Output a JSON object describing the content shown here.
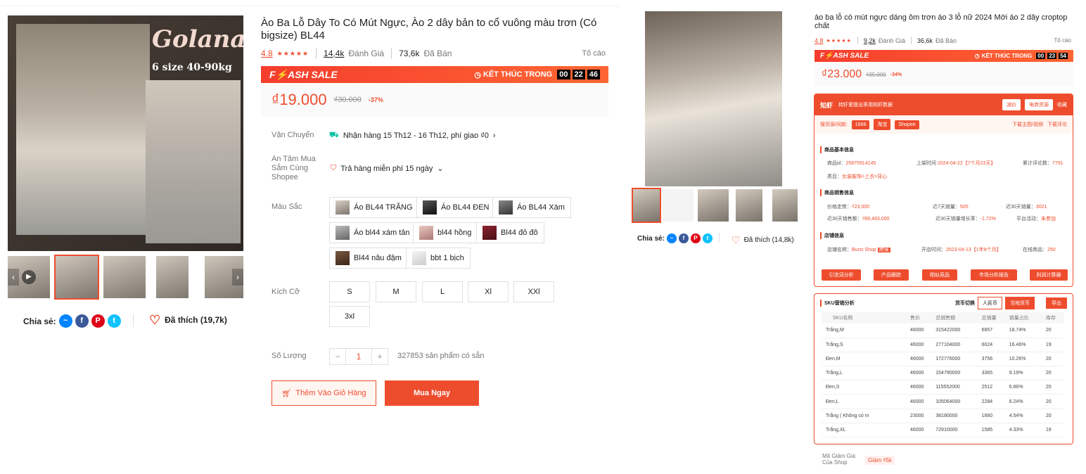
{
  "left": {
    "brand": "Golana",
    "brand_sub": "6 size 40-90kg",
    "title": "Ào Ba Lỗ Dây To Có Mút Ngực, Ào 2 dây bản to cổ vuông màu trơn (Có bigsize) BL44",
    "rating": "4.8",
    "stars": "★★★★★",
    "reviews_count": "14,4k",
    "reviews_label": "Đánh Giá",
    "sold_count": "73,6k",
    "sold_label": "Đã Bán",
    "report": "Tố cáo",
    "flash_title": "F⚡ASH SALE",
    "flash_end_label": "KẾT THÚC TRONG",
    "timer": [
      "00",
      "22",
      "46"
    ],
    "price": "₫19.000",
    "old_price": "₫30.000",
    "discount": "-37%",
    "shipping_label": "Vận Chuyển",
    "shipping_value": "Nhận hàng 15 Th12 - 16 Th12, phí giao ₫0",
    "assurance_label": "An Tâm Mua Sắm Cùng Shopee",
    "assurance_value": "Trả hàng miễn phí 15 ngày",
    "color_label": "Màu Sắc",
    "colors": [
      "Áo BL44 TRẮNG",
      "Áo BL44 ĐEN",
      "Áo BL44 Xám",
      "Áo bl44 xám tản",
      "bl44 hồng",
      "Bl44 đỏ đô",
      "Bl44 nâu đậm",
      "bbt 1 bịch"
    ],
    "size_label": "Kích Cỡ",
    "sizes": [
      "S",
      "M",
      "L",
      "Xl",
      "XXl",
      "3xl"
    ],
    "qty_label": "Số Lượng",
    "qty_minus": "−",
    "qty_value": "1",
    "qty_plus": "+",
    "stock": "327853 sản phẩm có sẵn",
    "add_cart": "Thêm Vào Giỏ Hàng",
    "buy_now": "Mua Ngay",
    "share_label": "Chia sẻ:",
    "liked": "Đã thích (19,7k)"
  },
  "middle": {
    "share_label": "Chia sẻ:",
    "liked": "Đã thích (14,8k)"
  },
  "right": {
    "title": "áo ba lỗ có mút ngực dáng ôm trơn áo 3 lỗ nữ 2024 Mới áo 2 dây croptop chất",
    "rating": "4.8",
    "stars": "★★★★★",
    "reviews_count": "9,2k",
    "reviews_label": "Đánh Giá",
    "sold_count": "36,6k",
    "sold_label": "Đã Bán",
    "report": "Tố cáo",
    "flash_title": "F⚡ASH SALE",
    "flash_end_label": "KẾT THÚC TRONG",
    "timer": [
      "00",
      "23",
      "54"
    ],
    "price": "₫23.000",
    "old_price": "₫35.000",
    "discount": "-34%",
    "plugin": {
      "logo": "知虾",
      "header_text": "转虾爱提出率用知虾数据",
      "btn1": "减价",
      "btn2": "电商资源",
      "btn3": "收藏",
      "source_label": "搜货源/同款:",
      "src1": "1688",
      "src2": "淘宝",
      "src3": "Shopee",
      "download_images": "下载主图/视频",
      "download_reviews": "下载评论",
      "sec_basic": "商品基本信息",
      "item_id_label": "商品id：",
      "item_id": "25875914145",
      "listed_label": "上架时间",
      "listed": "2024-04-22【7个月23天】",
      "reviews_label": "累计评论数：",
      "reviews": "7791",
      "category_label": "类目：",
      "category": "女装服饰>上衣>背心",
      "sec_sales": "商品销售信息",
      "price_trend_label": "价格走势：",
      "price_trend": "₫23,000",
      "sales7_label": "近7天销量：",
      "sales7": "505",
      "sales30_label": "近30天销量：",
      "sales30": "3021",
      "gmv30_label": "近30天销售额：",
      "gmv30": "₫89,483,000",
      "growth_label": "近30天销量增长率：",
      "growth": "-1.72%",
      "activity_label": "平台活动：",
      "activity": "未参加",
      "sec_shop": "店铺信息",
      "shop_label": "店铺名称：",
      "shop": "Burst Shop",
      "shop_badge": "跨境",
      "opened_label": "开店时间：",
      "opened": "2023-04-13【1年8个月】",
      "on_sale_label": "在线商品：",
      "on_sale": "250",
      "actions": [
        "引流词分析",
        "产品跟踪",
        "相似竞品",
        "市场分析报告",
        "利润计算器"
      ]
    },
    "sku": {
      "title": "SKU营销分析",
      "currency_label": "货币切换",
      "cny": "人民币",
      "local": "当地货币",
      "export": "导出",
      "headers": [
        "SKU名称",
        "售价",
        "总销售额",
        "总销量",
        "销量占比",
        "库存"
      ],
      "rows": [
        [
          "Trắng,M",
          "46000",
          "315422000",
          "6857",
          "18.74%",
          "20"
        ],
        [
          "Trắng,S",
          "46000",
          "277104000",
          "6024",
          "16.46%",
          "19"
        ],
        [
          "Đen,M",
          "46000",
          "172776000",
          "3756",
          "10.26%",
          "20"
        ],
        [
          "Trắng,L",
          "46000",
          "154790000",
          "3365",
          "9.19%",
          "20"
        ],
        [
          "Đen,S",
          "46000",
          "115552000",
          "2512",
          "6.86%",
          "20"
        ],
        [
          "Đen,L",
          "46000",
          "105064000",
          "2284",
          "6.24%",
          "20"
        ],
        [
          "Trắng ( Không có m",
          "23000",
          "38180000",
          "1660",
          "4.54%",
          "20"
        ],
        [
          "Trắng,XL",
          "46000",
          "72910000",
          "1585",
          "4.33%",
          "19"
        ]
      ]
    },
    "coupon_label": "Mã Giảm Giá Của Shop",
    "coupon": "Giảm ₫5k"
  },
  "colors": {
    "accent": "#ee4d2d"
  }
}
